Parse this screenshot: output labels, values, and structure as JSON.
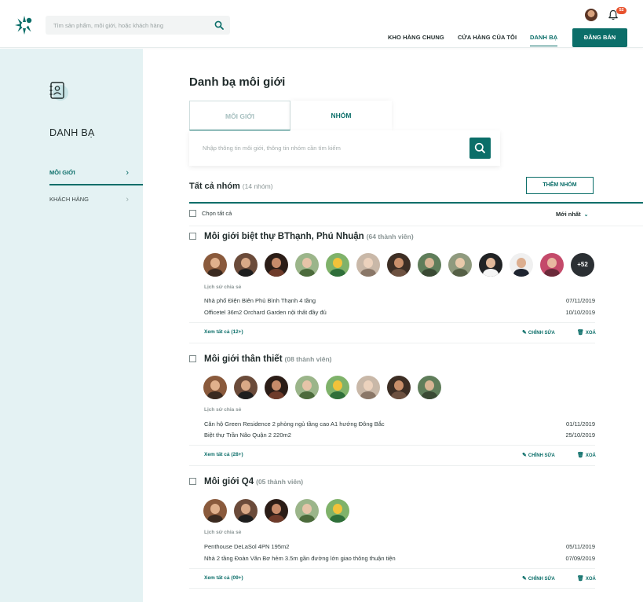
{
  "header": {
    "search_placeholder": "Tìm sản phẩm, môi giới, hoặc khách hàng",
    "notification_count": "52",
    "nav": [
      "KHO HÀNG CHUNG",
      "CỬA HÀNG CỦA TÔI",
      "DANH BẠ"
    ],
    "cta_label": "ĐĂNG BÁN"
  },
  "sidebar": {
    "title": "DANH BẠ",
    "items": [
      {
        "label": "MÔI GIỚI",
        "active": true
      },
      {
        "label": "KHÁCH HÀNG",
        "active": false
      }
    ]
  },
  "main": {
    "page_title": "Danh bạ môi giới",
    "tabs": [
      {
        "label": "MÔI GIỚI",
        "active": false
      },
      {
        "label": "NHÓM",
        "active": true
      }
    ],
    "search_placeholder": "Nhập thông tin môi giới, thông tin nhóm cần tìm kiếm",
    "list_title": "Tất cả nhóm",
    "list_count": "(14 nhóm)",
    "add_group_label": "THÊM NHÓM",
    "select_all_label": "Chọn tất cả",
    "sort_label": "Mới nhất",
    "groups": [
      {
        "name": "Môi giới biệt thự BThạnh, Phú Nhuận",
        "member_count": "(64 thành viên)",
        "more_members": "+52",
        "history_label": "Lịch sử chia sẻ",
        "history": [
          {
            "text": "Nhà phố Điện Biên Phủ Bình Thạnh 4 tầng",
            "date": "07/11/2019"
          },
          {
            "text": "Officetel 36m2 Orchard Garden nội thất đầy đủ",
            "date": "10/10/2019"
          }
        ],
        "see_all": "Xem tất cả (12+)",
        "edit_label": "CHỈNH SỬA",
        "delete_label": "XOÁ"
      },
      {
        "name": "Môi giới thân thiết",
        "member_count": "(08 thành viên)",
        "history_label": "Lịch sử chia sẻ",
        "history": [
          {
            "text": "Căn hộ Green Residence 2 phòng ngủ tầng cao A1 hướng Đông Bắc",
            "date": "01/11/2019"
          },
          {
            "text": "Biệt thự Trần Não Quận 2 220m2",
            "date": "25/10/2019"
          }
        ],
        "see_all": "Xem tất cả (28+)",
        "edit_label": "CHỈNH SỬA",
        "delete_label": "XOÁ"
      },
      {
        "name": "Môi giới Q4",
        "member_count": "(05 thành viên)",
        "history_label": "Lịch sử chia sẻ",
        "history": [
          {
            "text": "Penthouse DeLaSol 4PN 195m2",
            "date": "05/11/2019"
          },
          {
            "text": "Nhà 2 tầng Đoàn Văn Bơ hẻm 3.5m gần đường lớn giao thông thuận tiện",
            "date": "07/09/2019"
          }
        ],
        "see_all": "Xem tất cả (09+)",
        "edit_label": "CHỈNH SỬA",
        "delete_label": "XOÁ"
      }
    ]
  },
  "colors": {
    "brand": "#0b6e69",
    "sidebar_bg": "#e4f2f3",
    "badge": "#e8522e"
  },
  "icons": [
    "logo-icon",
    "search-icon",
    "bell-icon",
    "contact-book-icon",
    "chevron-right-icon",
    "chevron-down-icon",
    "edit-icon",
    "trash-icon"
  ]
}
